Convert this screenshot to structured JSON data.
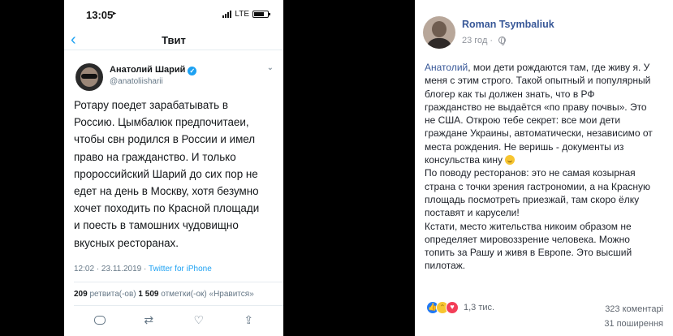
{
  "tweet": {
    "status_bar": {
      "time": "13:05",
      "network": "LTE"
    },
    "nav_title": "Твит",
    "author_name": "Анатолий Шарий",
    "author_handle": "@anatoliisharii",
    "text_lines": [
      "Ротару поедет зарабатывать в",
      "Россию. Цымбалюк предпочитаеи,",
      "чтобы свн родился в России и имел",
      "право на гражданство. И только",
      "пророссийский Шарий до сих пор не",
      "едет на день в Москву, хотя безумно",
      "хочет походить по Красной площади",
      "и поесть в тамошних чудовищно",
      "вкусных ресторанах."
    ],
    "meta_datetime": "12:02 · 23.11.2019 · ",
    "meta_source": "Twitter for iPhone",
    "retweets_count": "209",
    "retweets_label": " ретвита(-ов) ",
    "likes_count": "1 509",
    "likes_label": " отметки(-ок) «Нравится»",
    "icons": [
      "back-chevron-icon",
      "verified-badge-icon",
      "chevron-down-icon",
      "reply-icon",
      "retweet-icon",
      "like-icon",
      "share-icon"
    ]
  },
  "fb": {
    "author_name": "Roman Tsymbaliuk",
    "time": "23 год · ",
    "comment_mention": "Анатолий",
    "comment_lines": [
      ", мои дети рождаются там, где живу я. У",
      "меня с этим строго. Такой опытный и популярный",
      "блогер как ты должен знать, что в РФ",
      "гражданство не выдаётся «по праву почвы». Это",
      "не США. Открою тебе секрет: все мои дети",
      "граждане Украины, автоматически, независимо от",
      "места рождения. Не веришь - документы из",
      "консульства кину ",
      "По поводу ресторанов: это не самая козырная",
      "страна с точки зрения гастрономии, а на Красную",
      "площадь посмотреть приезжай, там скоро ёлку",
      "поставят и карусели!",
      "Кстати, место жительства никоим образом не",
      "определяет мировоззрение человека. Можно",
      "топить за Рашу и живя в Европе. Это высший",
      "пилотаж."
    ],
    "reactions_count": "1,3 тис.",
    "comments_count": "323 коментарі",
    "shares_count": "31 поширення",
    "icons": [
      "globe-icon",
      "smile-emoji-icon",
      "like-reaction-icon",
      "haha-reaction-icon",
      "love-reaction-icon"
    ]
  }
}
